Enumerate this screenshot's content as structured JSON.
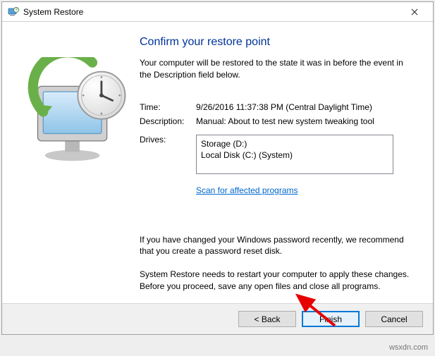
{
  "titlebar": {
    "title": "System Restore"
  },
  "content": {
    "heading": "Confirm your restore point",
    "subtext": "Your computer will be restored to the state it was in before the event in the Description field below.",
    "time_label": "Time:",
    "time_value": "9/26/2016 11:37:38 PM (Central Daylight Time)",
    "desc_label": "Description:",
    "desc_value": "Manual: About to test new system tweaking tool",
    "drives_label": "Drives:",
    "drives": [
      "Storage (D:)",
      "Local Disk (C:) (System)"
    ],
    "scan_link": "Scan for affected programs",
    "warn1": "If you have changed your Windows password recently, we recommend that you create a password reset disk.",
    "warn2": "System Restore needs to restart your computer to apply these changes. Before you proceed, save any open files and close all programs."
  },
  "footer": {
    "back": "< Back",
    "finish": "Finish",
    "cancel": "Cancel"
  },
  "attribution": "wsxdn.com"
}
